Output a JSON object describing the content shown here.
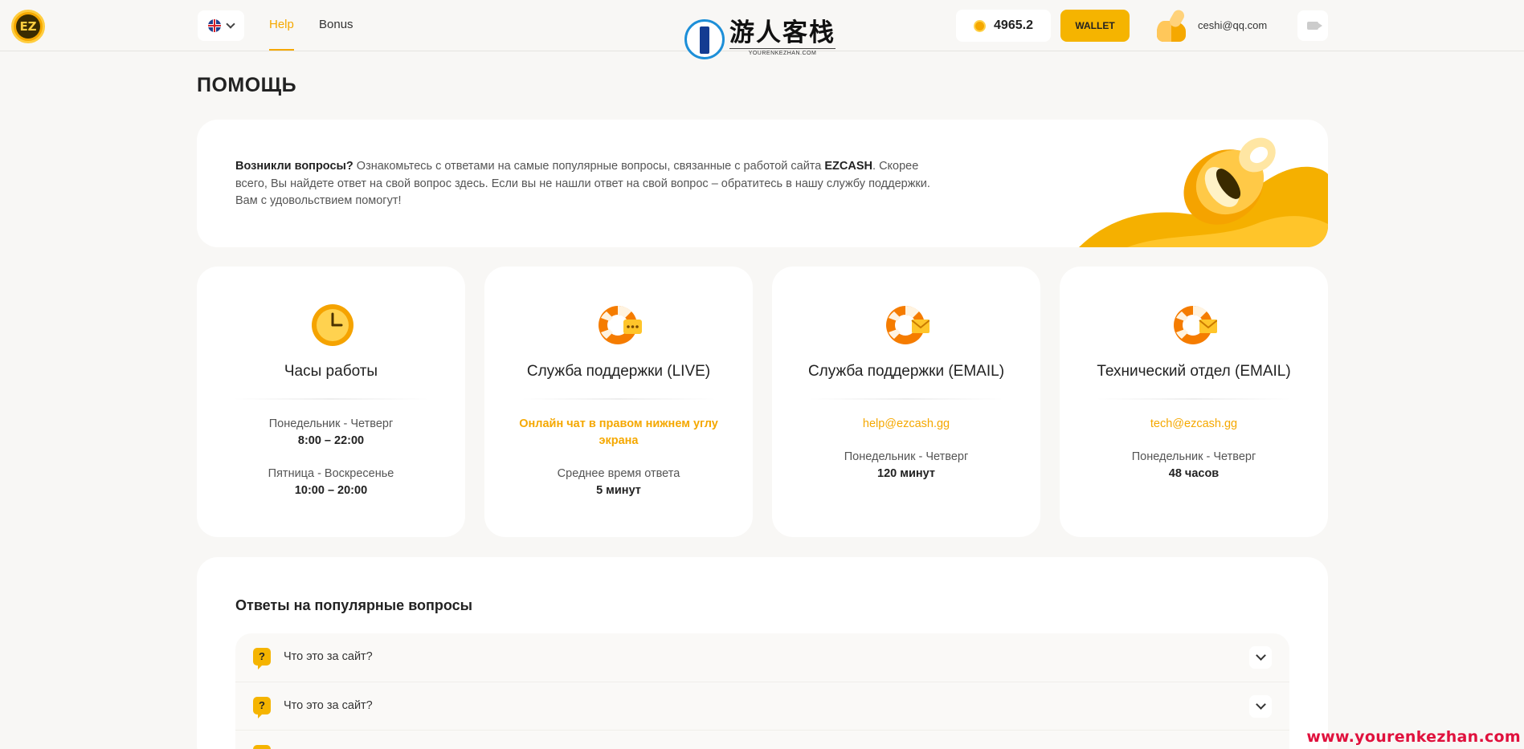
{
  "header": {
    "logo_text": "EZ",
    "nav": {
      "help": "Help",
      "bonus": "Bonus"
    },
    "balance": "4965.2",
    "wallet_label": "WALLET",
    "user_email": "ceshi@qq.com"
  },
  "watermark_logo": {
    "cn": "游人客栈",
    "en": "YOURENKEZHAN.COM"
  },
  "page_title": "ПОМОЩЬ",
  "intro": {
    "lead": "Возникли вопросы?",
    "text_1": " Ознакомьтесь с ответами на самые популярные вопросы, связанные с работой сайта ",
    "brand": "EZCASH",
    "text_2": ". Скорее всего, Вы найдете ответ на свой вопрос здесь. Если вы не нашли ответ на свой вопрос – обратитесь в нашу службу поддержки. Вам с удовольствием помогут!"
  },
  "cards": {
    "hours": {
      "title": "Часы работы",
      "line1": "Понедельник - Четверг",
      "line2": "8:00 – 22:00",
      "line3": "Пятница - Воскресенье",
      "line4": "10:00 – 20:00"
    },
    "live": {
      "title": "Служба поддержки (LIVE)",
      "accent": "Онлайн чат в правом нижнем углу экрана",
      "line3": "Среднее время ответа",
      "line4": "5 минут"
    },
    "email": {
      "title": "Служба поддержки (EMAIL)",
      "link": "help@ezcash.gg",
      "line3": "Понедельник - Четверг",
      "line4": "120 минут"
    },
    "tech": {
      "title": "Технический отдел (EMAIL)",
      "link": "tech@ezcash.gg",
      "line3": "Понедельник - Четверг",
      "line4": "48 часов"
    }
  },
  "faq": {
    "title": "Ответы на популярные вопросы",
    "items": [
      {
        "question": "Что это за сайт?"
      },
      {
        "question": "Что это за сайт?"
      }
    ]
  },
  "site_watermark": "www.yourenkezhan.com",
  "colors": {
    "accent": "#f5a800",
    "background": "#f8f7f5",
    "card": "#ffffff",
    "watermark": "#e0113d"
  }
}
